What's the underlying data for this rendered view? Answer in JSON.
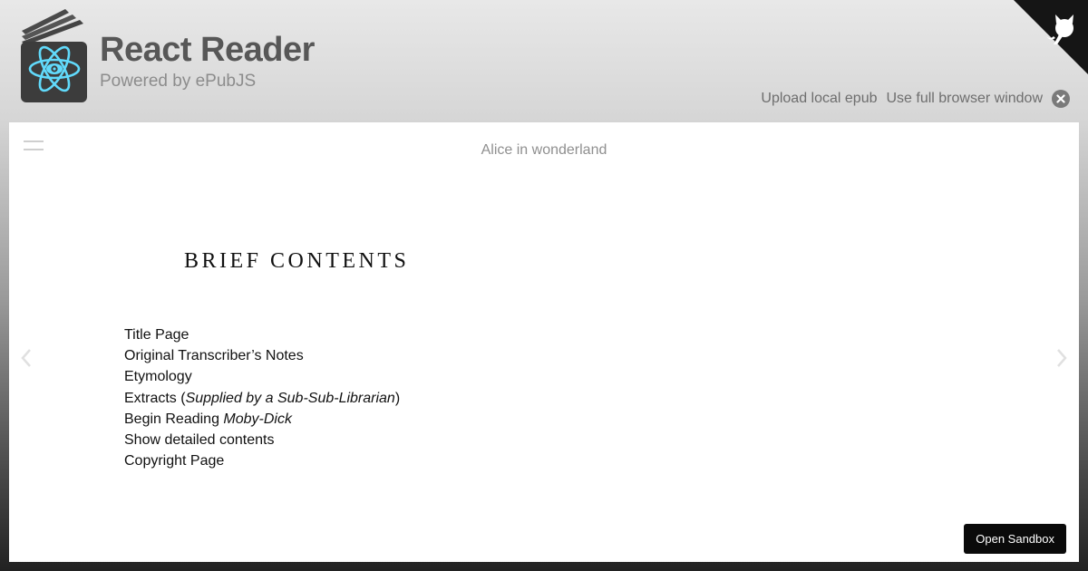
{
  "header": {
    "app_title": "React Reader",
    "app_subtitle": "Powered by ePubJS",
    "links": {
      "upload": "Upload local epub",
      "fullscreen": "Use full browser window"
    }
  },
  "reader": {
    "book_title": "Alice in wonderland",
    "page": {
      "heading": "BRIEF CONTENTS",
      "toc": [
        {
          "text": "Title Page"
        },
        {
          "text": "Original Transcriber’s Notes"
        },
        {
          "text": "Etymology"
        },
        {
          "text": "Extracts (",
          "italic": "Supplied by a Sub-Sub-Librarian",
          "after": ")"
        },
        {
          "text": "Begin Reading ",
          "italic": "Moby-Dick",
          "after": ""
        },
        {
          "text": "Show detailed contents"
        },
        {
          "text": "Copyright Page"
        }
      ]
    }
  },
  "sandbox_button": "Open Sandbox",
  "colors": {
    "react_logo": "#61dafb",
    "book_cover": "#3c3c3c",
    "header_text": "#575757"
  },
  "icons": {
    "logo": "react-book-logo-icon",
    "close": "close-icon",
    "corner": "github-octocat-icon",
    "menu": "hamburger-menu-icon",
    "prev": "chevron-left-icon",
    "next": "chevron-right-icon"
  }
}
